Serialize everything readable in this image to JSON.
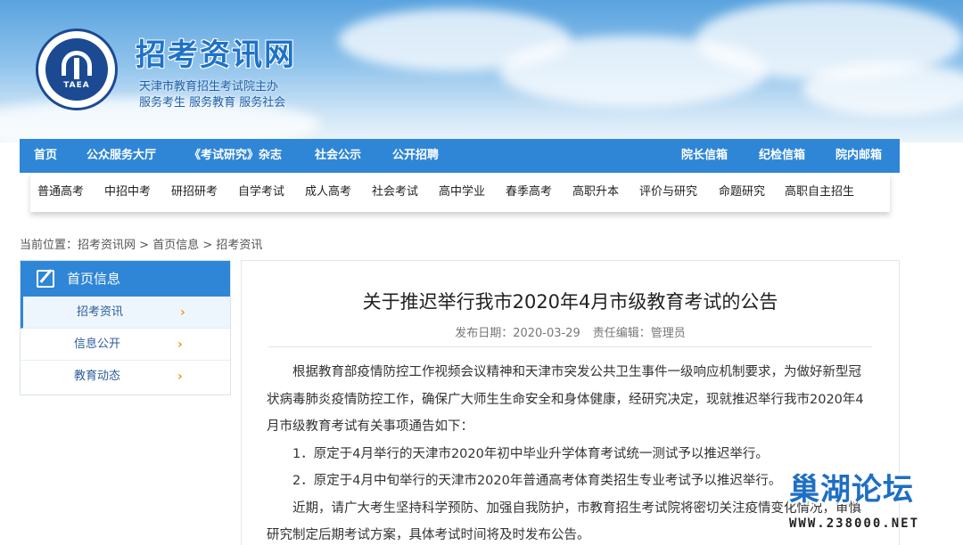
{
  "header": {
    "logo_text": "TAEA",
    "site_title": "招考资讯网",
    "subtitle_1": "天津市教育招生考试院主办",
    "subtitle_2": "服务考生 服务教育 服务社会"
  },
  "nav": {
    "left": [
      "首页",
      "公众服务大厅",
      "《考试研究》杂志",
      "社会公示",
      "公开招聘"
    ],
    "right": [
      "院长信箱",
      "纪检信箱",
      "院内邮箱"
    ]
  },
  "subnav": [
    "普通高考",
    "中招中考",
    "研招研考",
    "自学考试",
    "成人高考",
    "社会考试",
    "高中学业",
    "春季高考",
    "高职升本",
    "评价与研究",
    "命题研究",
    "高职自主招生"
  ],
  "breadcrumb": {
    "label": "当前位置：",
    "items": [
      "招考资讯网",
      "首页信息",
      "招考资讯"
    ],
    "sep": " > "
  },
  "sidebar": {
    "title": "首页信息",
    "items": [
      {
        "label": "招考资讯",
        "active": true
      },
      {
        "label": "信息公开",
        "active": false
      },
      {
        "label": "教育动态",
        "active": false
      }
    ],
    "chevron": "›"
  },
  "article": {
    "title": "关于推迟举行我市2020年4月市级教育考试的公告",
    "date_label": "发布日期：",
    "date": "2020-03-29",
    "editor_label": "责任编辑：",
    "editor": "管理员",
    "paragraphs": [
      "根据教育部疫情防控工作视频会议精神和天津市突发公共卫生事件一级响应机制要求，为做好新型冠状病毒肺炎疫情防控工作，确保广大师生生命安全和身体健康，经研究决定，现就推迟举行我市2020年4月市级教育考试有关事项通告如下：",
      "1．原定于4月举行的天津市2020年初中毕业升学体育考试统一测试予以推迟举行。",
      "2．原定于4月中旬举行的天津市2020年普通高考体育类招生专业考试予以推迟举行。",
      "近期，请广大考生坚持科学预防、加强自我防护，市教育招生考试院将密切关注疫情变化情况，审慎研究制定后期考试方案，具体考试时间将及时发布公告。"
    ]
  },
  "watermark": {
    "title": "巢湖论坛",
    "url": "WWW.238000.NET"
  },
  "colors": {
    "nav_blue": "#2f86d6",
    "title_blue": "#1e72c8",
    "chevron_orange": "#f29a1d"
  }
}
